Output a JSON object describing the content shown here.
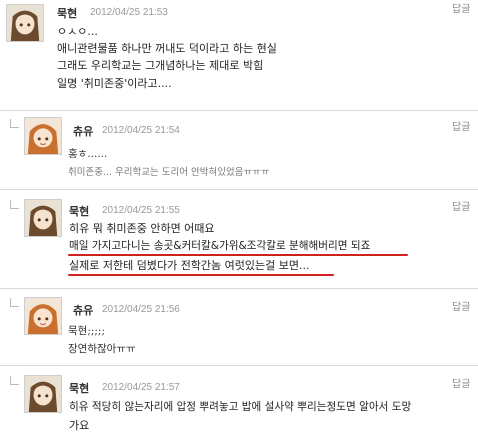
{
  "comments": [
    {
      "author": "묵현",
      "date": "2012/04/25 21:53",
      "reply_label": "답글",
      "lines": [
        "ㅇㅅㅇ...",
        "애니관련물품 하나만 꺼내도 덕이라고 하는 현실",
        "그래도 우리학교는 그개념하나는 제대로 박힘",
        "일명 '취미존중'이라고...."
      ]
    },
    {
      "author": "츄유",
      "date": "2012/04/25 21:54",
      "reply_label": "답글",
      "lines": [
        "홍ㅎ......",
        "취미존중... 우리학교는 도리어 안박혀있었음ㅠㅠㅠ"
      ]
    },
    {
      "author": "묵현",
      "date": "2012/04/25 21:55",
      "reply_label": "답글",
      "lines": [
        "히유 뭐 취미존중 안하면 어때요",
        "매일 가지고다니는 송곳&커터칼&가위&조각칼로 분해해버리면 되죠",
        "실제로 저한테 덤볐다가 전학간놈 여럿있는걸 보면..."
      ]
    },
    {
      "author": "츄유",
      "date": "2012/04/25 21:56",
      "reply_label": "답글",
      "lines": [
        "묵현;;;;;",
        "장연하잖아ㅠㅠ"
      ]
    },
    {
      "author": "묵현",
      "date": "2012/04/25 21:57",
      "reply_label": "답글",
      "lines": [
        "히유 적당히 않는자리에 압정 뿌려놓고 밥에 설사약 뿌리는정도면 알아서 도망",
        "가요"
      ]
    }
  ]
}
